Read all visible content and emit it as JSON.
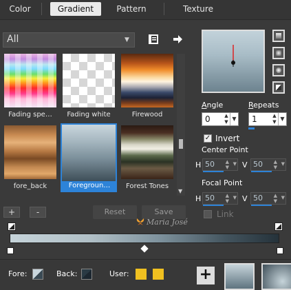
{
  "tabs": [
    {
      "label": "Color"
    },
    {
      "label": "Gradient"
    },
    {
      "label": "Pattern"
    },
    {
      "label": "Texture"
    }
  ],
  "category": {
    "selected": "All"
  },
  "swatches": [
    {
      "name": "Fading spe…"
    },
    {
      "name": "Fading white"
    },
    {
      "name": "Firewood"
    },
    {
      "name": "fore_back"
    },
    {
      "name": "Foregroun…"
    },
    {
      "name": "Forest Tones"
    }
  ],
  "buttons": {
    "add": "+",
    "remove": "-",
    "reset": "Reset",
    "save": "Save"
  },
  "angle": {
    "label": "Angle",
    "value": "0"
  },
  "repeats": {
    "label": "Repeats",
    "value": "1"
  },
  "invert": {
    "label": "Invert",
    "checked": true
  },
  "center": {
    "label": "Center Point",
    "h_label": "H",
    "h": "50",
    "v_label": "V",
    "v": "50"
  },
  "focal": {
    "label": "Focal Point",
    "h_label": "H",
    "h": "50",
    "v_label": "V",
    "v": "50"
  },
  "link": {
    "label": "Link",
    "checked": false
  },
  "watermark": "Maria José",
  "footer": {
    "fore_label": "Fore:",
    "back_label": "Back:",
    "user_label": "User:"
  },
  "colors": {
    "accent": "#2d83d8",
    "user_swatch": "#f0c020"
  }
}
